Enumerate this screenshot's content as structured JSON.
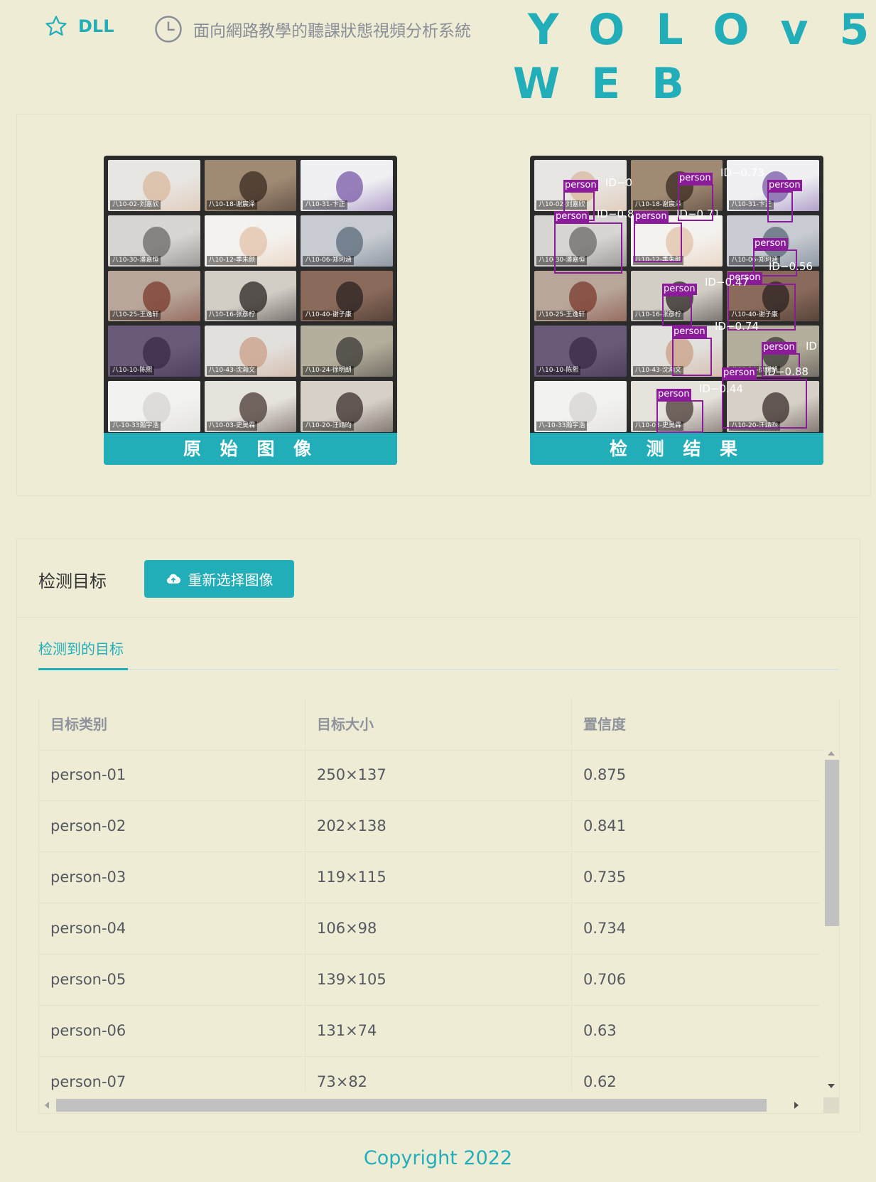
{
  "header": {
    "brand": "DLL",
    "subtitle": "面向網路教學的聽課狀態視頻分析系統",
    "title_line1": "YOLOv5",
    "title_line2": "WEB"
  },
  "images": {
    "original_caption": "原 始 图 像",
    "result_caption": "检 测 结 果",
    "tile_names": [
      "八10-02-刘嘉欣",
      "八10-18-谢宸泽",
      "八10-31-卞正",
      "八10-30-潘嘉恒",
      "八10-12-季朱颜",
      "八10-06-郑珂涵",
      "八10-25-王逸轩",
      "八10-16-张彦柠",
      "八10-40-谢子康",
      "八10-10-陈熙",
      "八10-43-沈瀚文",
      "八10-24-徐明朗",
      "八-10-33瀚宇浩",
      "八10-03-史昊霖",
      "八10-20-汪靖昀"
    ],
    "detections": [
      {
        "label": "person",
        "id": "ID−0"
      },
      {
        "label": "person",
        "id": "ID−0.73"
      },
      {
        "label": "person",
        "id": ""
      },
      {
        "label": "person",
        "id": "ID−0.8"
      },
      {
        "label": "person",
        "id": "ID−0.71"
      },
      {
        "label": "person",
        "id": ""
      },
      {
        "label": "person",
        "id": "ID−0.56"
      },
      {
        "label": "person",
        "id": "ID−0.47"
      },
      {
        "label": "person",
        "id": "ID−0.74"
      },
      {
        "label": "person",
        "id": "ID"
      },
      {
        "label": "person",
        "id": "ID−0.88"
      },
      {
        "label": "person",
        "id": "ID−0.44"
      }
    ]
  },
  "detect": {
    "title": "检测目标",
    "reselect_button": "重新选择图像",
    "tab_label": "检测到的目标",
    "columns": [
      "目标类别",
      "目标大小",
      "置信度"
    ],
    "rows": [
      [
        "person-01",
        "250×137",
        "0.875"
      ],
      [
        "person-02",
        "202×138",
        "0.841"
      ],
      [
        "person-03",
        "119×115",
        "0.735"
      ],
      [
        "person-04",
        "106×98",
        "0.734"
      ],
      [
        "person-05",
        "139×105",
        "0.706"
      ],
      [
        "person-06",
        "131×74",
        "0.63"
      ],
      [
        "person-07",
        "73×82",
        "0.62"
      ]
    ]
  },
  "footer": {
    "copyright": "Copyright 2022"
  },
  "colors": {
    "accent": "#21aeb9",
    "background": "#efecd6",
    "box": "#8a1c9a"
  }
}
